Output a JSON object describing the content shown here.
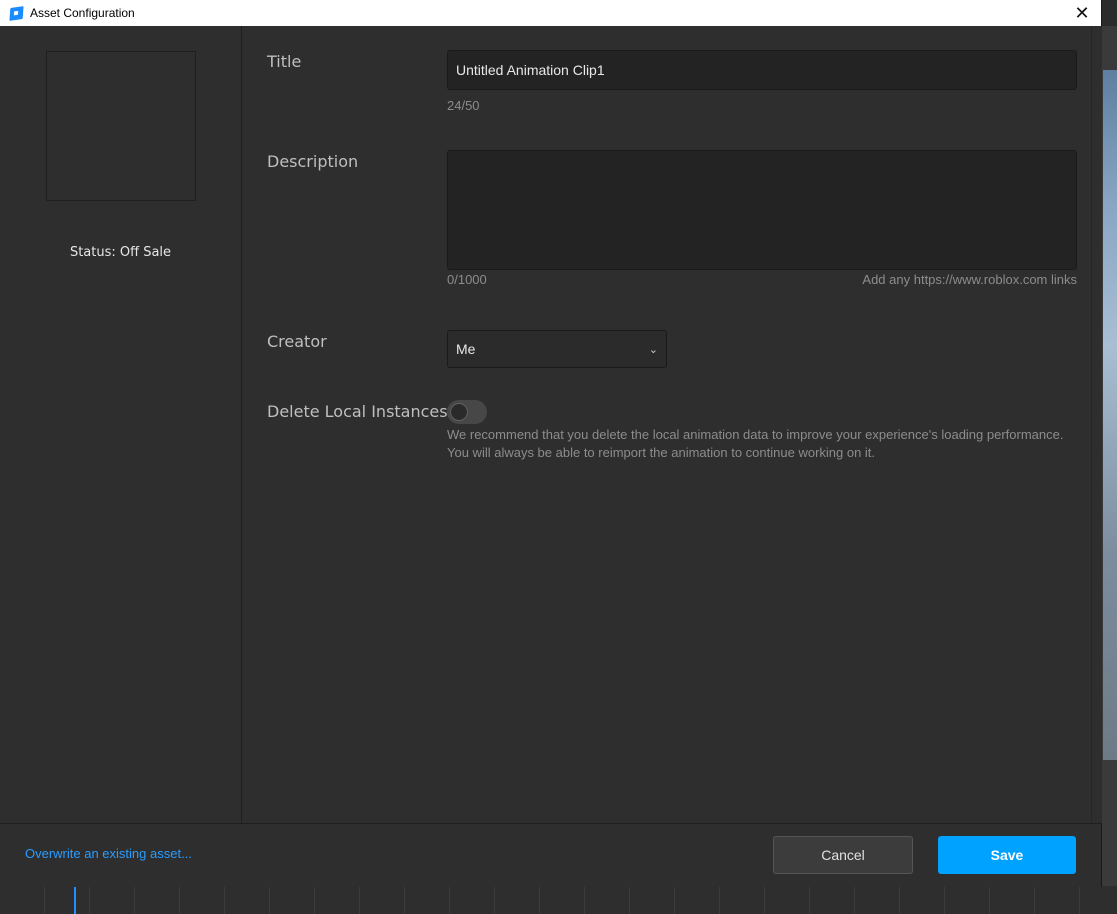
{
  "window": {
    "title": "Asset Configuration",
    "close_glyph": "✕"
  },
  "left_panel": {
    "status": "Status: Off Sale"
  },
  "form": {
    "title_label": "Title",
    "title_value": "Untitled Animation Clip1",
    "title_counter": "24/50",
    "description_label": "Description",
    "description_value": "",
    "description_counter": "0/1000",
    "description_hint": "Add any https://www.roblox.com links",
    "creator_label": "Creator",
    "creator_value": "Me",
    "delete_label": "Delete Local Instances",
    "delete_toggle_on": false,
    "delete_note": "We recommend that you delete the local animation data to improve your experience's loading performance. You will always be able to reimport the animation to continue working on it."
  },
  "footer": {
    "overwrite_link": "Overwrite an existing asset...",
    "cancel_label": "Cancel",
    "save_label": "Save"
  },
  "icons": {
    "app": "roblox-studio-icon",
    "close": "close-icon",
    "dropdown": "chevron-down-icon"
  },
  "colors": {
    "accent": "#00a2ff",
    "link": "#2a9dff",
    "panel": "#2e2e2e",
    "input": "#232323"
  }
}
